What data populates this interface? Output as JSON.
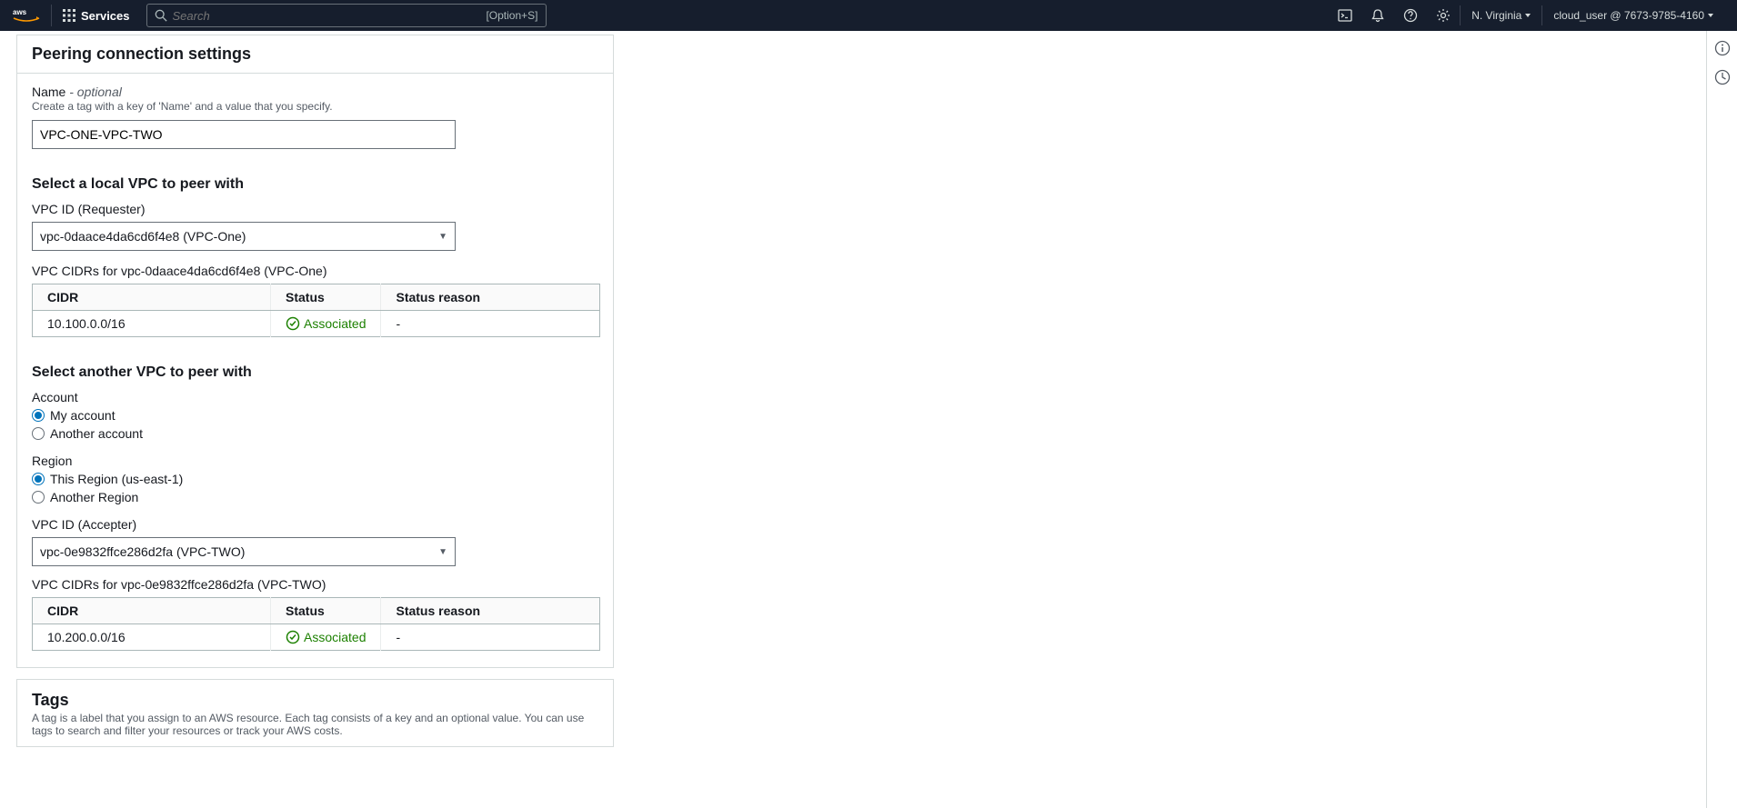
{
  "nav": {
    "services_label": "Services",
    "search_placeholder": "Search",
    "search_shortcut": "[Option+S]",
    "region": "N. Virginia",
    "account": "cloud_user @ 7673-9785-4160"
  },
  "panel": {
    "title": "Peering connection settings",
    "name_label": "Name",
    "optional_label": " - optional",
    "name_desc": "Create a tag with a key of 'Name' and a value that you specify.",
    "name_value": "VPC-ONE-VPC-TWO",
    "local_heading": "Select a local VPC to peer with",
    "requester_label": "VPC ID (Requester)",
    "requester_value": "vpc-0daace4da6cd6f4e8 (VPC-One)",
    "requester_cidr_heading": "VPC CIDRs for vpc-0daace4da6cd6f4e8 (VPC-One)",
    "table_headers": {
      "cidr": "CIDR",
      "status": "Status",
      "reason": "Status reason"
    },
    "requester_cidrs": [
      {
        "cidr": "10.100.0.0/16",
        "status": "Associated",
        "reason": "-"
      }
    ],
    "another_heading": "Select another VPC to peer with",
    "account_label": "Account",
    "account_options": {
      "mine": "My account",
      "other": "Another account"
    },
    "region_label": "Region",
    "region_options": {
      "this": "This Region (us-east-1)",
      "other": "Another Region"
    },
    "accepter_label": "VPC ID (Accepter)",
    "accepter_value": "vpc-0e9832ffce286d2fa (VPC-TWO)",
    "accepter_cidr_heading": "VPC CIDRs for vpc-0e9832ffce286d2fa (VPC-TWO)",
    "accepter_cidrs": [
      {
        "cidr": "10.200.0.0/16",
        "status": "Associated",
        "reason": "-"
      }
    ]
  },
  "tags": {
    "title": "Tags",
    "desc": "A tag is a label that you assign to an AWS resource. Each tag consists of a key and an optional value. You can use tags to search and filter your resources or track your AWS costs."
  }
}
